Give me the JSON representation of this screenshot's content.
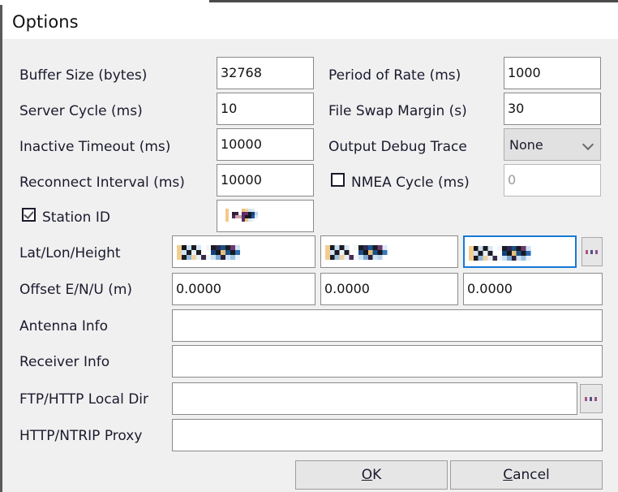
{
  "window": {
    "title": "Options",
    "parent_title_fragment": ""
  },
  "fields": {
    "buffer_size": {
      "label": "Buffer Size (bytes)",
      "value": "32768"
    },
    "server_cycle": {
      "label": "Server Cycle  (ms)",
      "value": "10"
    },
    "inactive_timeout": {
      "label": "Inactive Timeout (ms)",
      "value": "10000"
    },
    "reconnect_interval": {
      "label": "Reconnect Interval  (ms)",
      "value": "10000"
    },
    "period_of_rate": {
      "label": "Period of Rate (ms)",
      "value": "1000"
    },
    "file_swap_margin": {
      "label": "File Swap Margin (s)",
      "value": "30"
    },
    "output_debug_trace": {
      "label": "Output Debug Trace",
      "value": "None"
    },
    "nmea_cycle": {
      "label": "NMEA Cycle (ms)",
      "value": "0",
      "checked": false
    },
    "station_id": {
      "label": "Station ID",
      "value": "",
      "checked": true
    },
    "lat_lon_height": {
      "label": "Lat/Lon/Height",
      "lat": "",
      "lon": "",
      "height": "",
      "browse_label": "..."
    },
    "offset_enu": {
      "label": "Offset E/N/U (m)",
      "east": "0.0000",
      "north": "0.0000",
      "up": "0.0000"
    },
    "antenna_info": {
      "label": "Antenna Info",
      "value": ""
    },
    "receiver_info": {
      "label": "Receiver Info",
      "value": ""
    },
    "ftp_http_local_dir": {
      "label": "FTP/HTTP Local Dir",
      "value": "",
      "browse_label": "..."
    },
    "http_ntrip_proxy": {
      "label": "HTTP/NTRIP Proxy",
      "value": ""
    }
  },
  "buttons": {
    "ok": {
      "mnemonic": "O",
      "rest": "K"
    },
    "cancel": {
      "mnemonic": "C",
      "rest": "ancel"
    }
  },
  "colors": {
    "dialog_bg": "#f0f0f0",
    "titlebar_bg": "#ffffff",
    "text": "#1a1a2e",
    "input_border": "#8a8a8a",
    "focus_border": "#1679d6",
    "button_face": "#e6e6e6"
  }
}
